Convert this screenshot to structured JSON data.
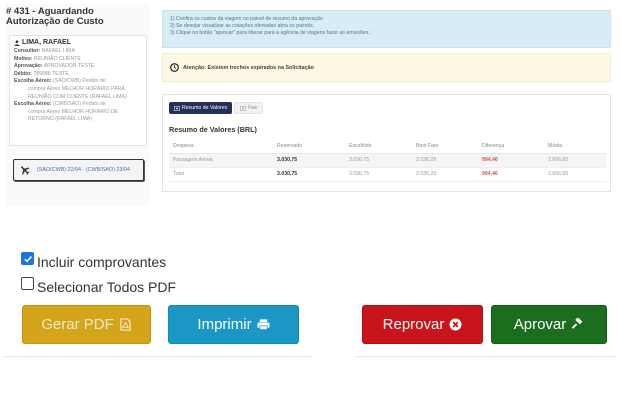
{
  "request": {
    "title": "# 431 - Aguardando Autorização de Custo"
  },
  "traveler": {
    "name": "LIMA, RAFAEL",
    "fields": [
      {
        "key": "Consultor:",
        "value": "RAFAEL LIMA"
      },
      {
        "key": "Motivo:",
        "value": "REUNIÃO CLIENTE"
      },
      {
        "key": "Aprovação:",
        "value": "APROVADOR TESTE"
      },
      {
        "key": "Débito:",
        "value": "789088 TESTE"
      }
    ],
    "choice_label": "Escolha Aéreo:",
    "choice_1": "(SAO/CWB) Pedido de",
    "choice_1_lines": [
      "compra Aéreo MELHOR HORÁRIO PARA",
      "REUNIÃO COM CLIENTE (RAFAEL LIMA)"
    ],
    "choice_2": "(CWB/SAO) Pedido de",
    "choice_2_lines": [
      "compra Aéreo MELHOR HORÁRIO DE",
      "RETORNO (RAFAEL LIMA)"
    ]
  },
  "flight": {
    "icon": "airplane-icon",
    "text": "(SAO/CWB) 22/04 - (CWB/SAO) 23/04"
  },
  "info": {
    "lines": [
      "1) Confira os custos da viagem no painel de resumo da aprovação",
      "2) Se desejar visualizar as cotações ofertadas abra os painéis.",
      "3) Clique no botão \"aprovar\" para liberar para a agência de viagens fazer as emissões.;"
    ]
  },
  "warning": {
    "icon": "clock-icon",
    "text": "Atenção: Existem trechos expirados na Solicitação"
  },
  "values": {
    "tabs": [
      {
        "label": "Resumo de Valores",
        "icon": "money-icon",
        "active": true
      },
      {
        "label": "Fee",
        "icon": "money-icon",
        "active": false
      }
    ],
    "title": "Resumo de Valores (BRL)",
    "headers": [
      "Despesa",
      "Reservado",
      "Escolhido",
      "Best Fare",
      "Diferença",
      "Média"
    ],
    "rows": [
      [
        "Passagem Aérea",
        "3.030,75",
        "3.030,75",
        "2.036,29",
        "994,46",
        "2.666,65"
      ],
      [
        "Total",
        "3.030,75",
        "3.030,75",
        "2.036,29",
        "994,46",
        "2.666,65"
      ]
    ]
  },
  "options": {
    "include_receipts": {
      "label": "Incluir comprovantes",
      "checked": true
    },
    "select_all_pdf": {
      "label": "Selecionar Todos PDF",
      "checked": false
    }
  },
  "actions": {
    "gerar_pdf": "Gerar PDF",
    "imprimir": "Imprimir",
    "reprovar": "Reprovar",
    "aprovar": "Aprovar"
  },
  "colors": {
    "gerar": "#d4a51a",
    "imprimir": "#1a97c4",
    "reprovar": "#c9141b",
    "aprovar": "#1a6e1d",
    "info_bg": "#d7ecf4",
    "warning_bg": "#fcf8e3",
    "difference": "#d9534f"
  }
}
